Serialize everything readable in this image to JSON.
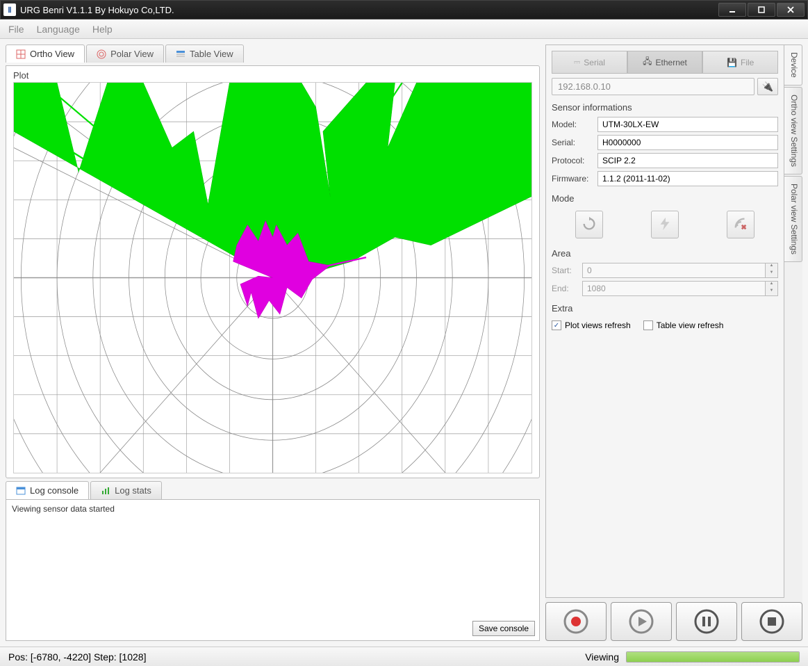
{
  "window": {
    "title": "URG Benri V1.1.1 By Hokuyo Co,LTD."
  },
  "menu": {
    "file": "File",
    "language": "Language",
    "help": "Help"
  },
  "viewTabs": {
    "ortho": "Ortho View",
    "polar": "Polar View",
    "table": "Table View"
  },
  "plot": {
    "title": "Plot"
  },
  "logTabs": {
    "console": "Log console",
    "stats": "Log stats"
  },
  "log": {
    "text": "Viewing sensor data started"
  },
  "saveConsole": "Save console",
  "connTabs": {
    "serial": "Serial",
    "ethernet": "Ethernet",
    "file": "File"
  },
  "ipAddress": "192.168.0.10",
  "sensorInfo": {
    "title": "Sensor informations",
    "modelLabel": "Model:",
    "model": "UTM-30LX-EW",
    "serialLabel": "Serial:",
    "serial": "H0000000",
    "protocolLabel": "Protocol:",
    "protocol": "SCIP 2.2",
    "firmwareLabel": "Firmware:",
    "firmware": "1.1.2 (2011-11-02)"
  },
  "mode": {
    "title": "Mode"
  },
  "area": {
    "title": "Area",
    "startLabel": "Start:",
    "start": "0",
    "endLabel": "End:",
    "end": "1080"
  },
  "extra": {
    "title": "Extra",
    "plotRefresh": "Plot views refresh",
    "tableRefresh": "Table view refresh"
  },
  "sideTabs": {
    "device": "Device",
    "ortho": "Ortho view Settings",
    "polar": "Polar view Settings"
  },
  "status": {
    "pos": "Pos: [-6780, -4220] Step: [1028]",
    "viewing": "Viewing"
  }
}
